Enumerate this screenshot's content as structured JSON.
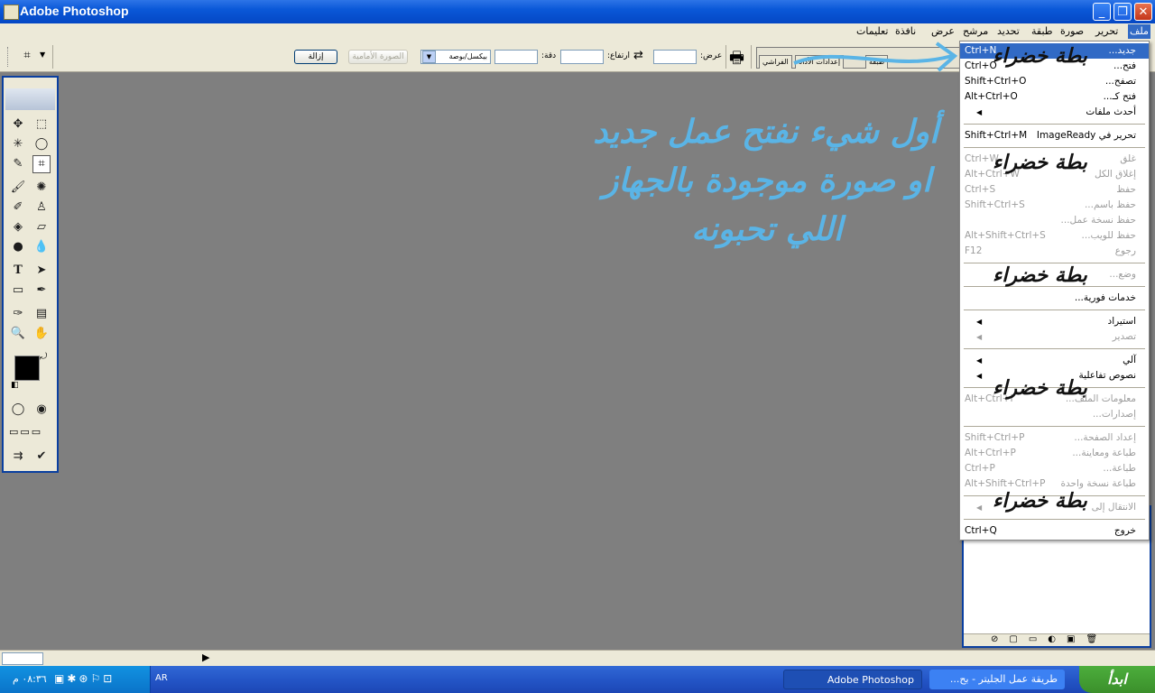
{
  "window": {
    "title": "Adobe Photoshop",
    "controls": {
      "minimize": "_",
      "restore": "❐",
      "close": "✕"
    }
  },
  "menubar": {
    "items": [
      "ملف",
      "تحرير",
      "صورة",
      "طبقة",
      "تحديد",
      "مرشح",
      "عرض",
      "نافذة",
      "تعليمات"
    ],
    "active_index": 0
  },
  "options": {
    "width_label": "عرض:",
    "height_label": "ارتفاع:",
    "resolution_label": "دقة:",
    "unit_selected": "بيكسل/بوصة",
    "front_image_button": "الصورة الأمامية",
    "clear_button": "إزالة",
    "palette_tabs": [
      "الفراشي",
      "إعدادات الأداة",
      "طبقة"
    ]
  },
  "file_menu": {
    "rows": [
      {
        "label": "جديد...",
        "shortcut": "Ctrl+N",
        "enabled": true,
        "highlighted": true
      },
      {
        "label": "فتح...",
        "shortcut": "Ctrl+O",
        "enabled": true
      },
      {
        "label": "تصفح...",
        "shortcut": "Shift+Ctrl+O",
        "enabled": true
      },
      {
        "label": "فتح كـ...",
        "shortcut": "Alt+Ctrl+O",
        "enabled": true
      },
      {
        "label": "أحدث ملفات",
        "shortcut": "",
        "enabled": true,
        "submenu": true
      },
      {
        "separator": true
      },
      {
        "label": "تحرير في ImageReady",
        "shortcut": "Shift+Ctrl+M",
        "enabled": true
      },
      {
        "separator": true
      },
      {
        "label": "غلق",
        "shortcut": "Ctrl+W",
        "enabled": false
      },
      {
        "label": "إغلاق الكل",
        "shortcut": "Alt+Ctrl+W",
        "enabled": false
      },
      {
        "label": "حفظ",
        "shortcut": "Ctrl+S",
        "enabled": false
      },
      {
        "label": "حفظ باسم...",
        "shortcut": "Shift+Ctrl+S",
        "enabled": false
      },
      {
        "label": "حفظ نسخة عمل...",
        "shortcut": "",
        "enabled": false
      },
      {
        "label": "حفظ للويب...",
        "shortcut": "Alt+Shift+Ctrl+S",
        "enabled": false
      },
      {
        "label": "رجوع",
        "shortcut": "F12",
        "enabled": false
      },
      {
        "separator": true
      },
      {
        "label": "وضع...",
        "shortcut": "",
        "enabled": false
      },
      {
        "separator": true
      },
      {
        "label": "خدمات فورية...",
        "shortcut": "",
        "enabled": true
      },
      {
        "separator": true
      },
      {
        "label": "استيراد",
        "shortcut": "",
        "enabled": true,
        "submenu": true
      },
      {
        "label": "تصدير",
        "shortcut": "",
        "enabled": false,
        "submenu": true
      },
      {
        "separator": true
      },
      {
        "label": "آلي",
        "shortcut": "",
        "enabled": true,
        "submenu": true
      },
      {
        "label": "نصوص تفاعلية",
        "shortcut": "",
        "enabled": true,
        "submenu": true
      },
      {
        "separator": true
      },
      {
        "label": "معلومات الملف...",
        "shortcut": "Alt+Ctrl+I",
        "enabled": false
      },
      {
        "label": "إصدارات...",
        "shortcut": "",
        "enabled": false
      },
      {
        "separator": true
      },
      {
        "label": "إعداد الصفحة...",
        "shortcut": "Shift+Ctrl+P",
        "enabled": false
      },
      {
        "label": "طباعة ومعاينة...",
        "shortcut": "Alt+Ctrl+P",
        "enabled": false
      },
      {
        "label": "طباعة...",
        "shortcut": "Ctrl+P",
        "enabled": false
      },
      {
        "label": "طباعة نسخة واحدة",
        "shortcut": "Alt+Shift+Ctrl+P",
        "enabled": false
      },
      {
        "separator": true
      },
      {
        "label": "الانتقال إلى",
        "shortcut": "",
        "enabled": false,
        "submenu": true
      },
      {
        "separator": true
      },
      {
        "label": "خروج",
        "shortcut": "Ctrl+Q",
        "enabled": true
      }
    ]
  },
  "annotation": {
    "lines": [
      "أول شيء نفتح عمل جديد",
      "او صورة موجودة بالجهاز",
      "اللي تحبونه"
    ],
    "stamp": "بطة خضراء",
    "color": "#5ab4e6"
  },
  "taskbar": {
    "start_label": "ابدأ",
    "tasks": [
      "طريقة عمل الجليتر - بح...",
      "Adobe Photoshop"
    ],
    "lang": "AR",
    "clock": "٠٨:٣٦ م"
  }
}
